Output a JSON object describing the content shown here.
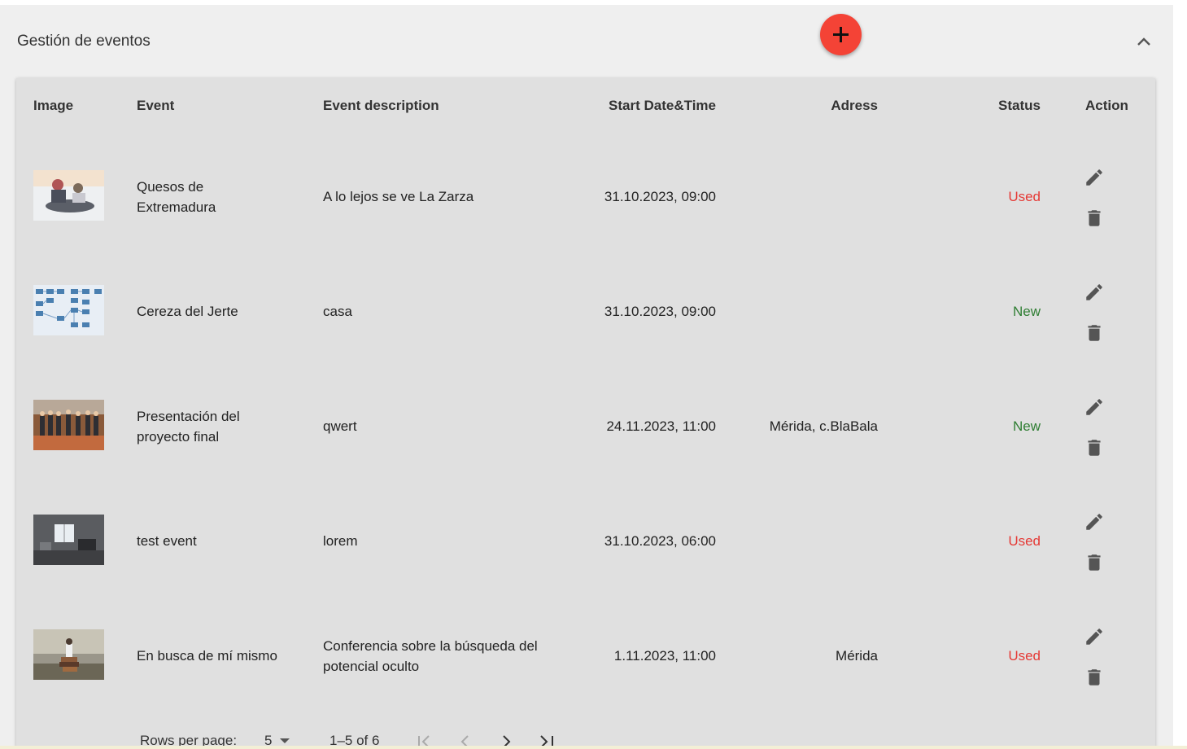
{
  "panel": {
    "title": "Gestión de eventos"
  },
  "table": {
    "headers": {
      "image": "Image",
      "event": "Event",
      "description": "Event description",
      "start": "Start Date&Time",
      "address": "Adress",
      "status": "Status",
      "action": "Action"
    },
    "rows": [
      {
        "event": "Quesos de Extremadura",
        "description": "A lo lejos se ve La Zarza",
        "start": "31.10.2023, 09:00",
        "address": "",
        "status": "Used",
        "thumb": "sledding-photo"
      },
      {
        "event": "Cereza del Jerte",
        "description": "casa",
        "start": "31.10.2023, 09:00",
        "address": "",
        "status": "New",
        "thumb": "diagram-photo"
      },
      {
        "event": "Presentación del proyecto final",
        "description": "qwert",
        "start": "24.11.2023, 11:00",
        "address": "Mérida, c.BlaBala",
        "status": "New",
        "thumb": "group-photo"
      },
      {
        "event": "test event",
        "description": "lorem",
        "start": "31.10.2023, 06:00",
        "address": "",
        "status": "Used",
        "thumb": "room-photo"
      },
      {
        "event": "En busca de mí mismo",
        "description": "Conferencia sobre la búsqueda del potencial oculto",
        "start": "1.11.2023, 11:00",
        "address": "Mérida",
        "status": "Used",
        "thumb": "books-photo"
      }
    ]
  },
  "pagination": {
    "rows_per_page_label": "Rows per page:",
    "rows_per_page_value": "5",
    "range": "1–5 of 6"
  },
  "colors": {
    "fab": "#f44336",
    "used": "#e53935",
    "new": "#2e7d32"
  },
  "icons": [
    "plus-icon",
    "chevron-up-icon",
    "edit-icon",
    "delete-icon",
    "first-page-icon",
    "prev-page-icon",
    "next-page-icon",
    "last-page-icon",
    "dropdown-arrow-icon"
  ]
}
